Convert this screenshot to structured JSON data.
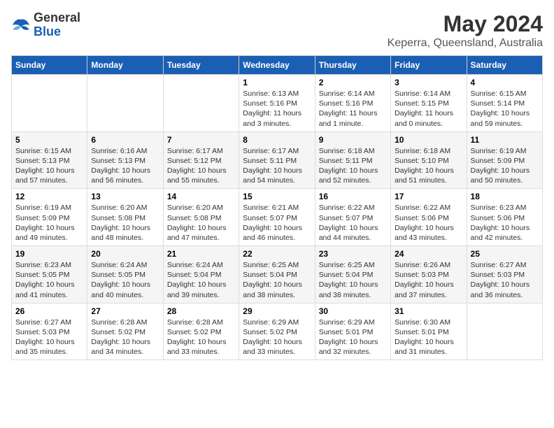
{
  "header": {
    "logo_line1": "General",
    "logo_line2": "Blue",
    "title": "May 2024",
    "subtitle": "Keperra, Queensland, Australia"
  },
  "weekdays": [
    "Sunday",
    "Monday",
    "Tuesday",
    "Wednesday",
    "Thursday",
    "Friday",
    "Saturday"
  ],
  "weeks": [
    [
      {
        "day": "",
        "detail": ""
      },
      {
        "day": "",
        "detail": ""
      },
      {
        "day": "",
        "detail": ""
      },
      {
        "day": "1",
        "detail": "Sunrise: 6:13 AM\nSunset: 5:16 PM\nDaylight: 11 hours and 3 minutes."
      },
      {
        "day": "2",
        "detail": "Sunrise: 6:14 AM\nSunset: 5:16 PM\nDaylight: 11 hours and 1 minute."
      },
      {
        "day": "3",
        "detail": "Sunrise: 6:14 AM\nSunset: 5:15 PM\nDaylight: 11 hours and 0 minutes."
      },
      {
        "day": "4",
        "detail": "Sunrise: 6:15 AM\nSunset: 5:14 PM\nDaylight: 10 hours and 59 minutes."
      }
    ],
    [
      {
        "day": "5",
        "detail": "Sunrise: 6:15 AM\nSunset: 5:13 PM\nDaylight: 10 hours and 57 minutes."
      },
      {
        "day": "6",
        "detail": "Sunrise: 6:16 AM\nSunset: 5:13 PM\nDaylight: 10 hours and 56 minutes."
      },
      {
        "day": "7",
        "detail": "Sunrise: 6:17 AM\nSunset: 5:12 PM\nDaylight: 10 hours and 55 minutes."
      },
      {
        "day": "8",
        "detail": "Sunrise: 6:17 AM\nSunset: 5:11 PM\nDaylight: 10 hours and 54 minutes."
      },
      {
        "day": "9",
        "detail": "Sunrise: 6:18 AM\nSunset: 5:11 PM\nDaylight: 10 hours and 52 minutes."
      },
      {
        "day": "10",
        "detail": "Sunrise: 6:18 AM\nSunset: 5:10 PM\nDaylight: 10 hours and 51 minutes."
      },
      {
        "day": "11",
        "detail": "Sunrise: 6:19 AM\nSunset: 5:09 PM\nDaylight: 10 hours and 50 minutes."
      }
    ],
    [
      {
        "day": "12",
        "detail": "Sunrise: 6:19 AM\nSunset: 5:09 PM\nDaylight: 10 hours and 49 minutes."
      },
      {
        "day": "13",
        "detail": "Sunrise: 6:20 AM\nSunset: 5:08 PM\nDaylight: 10 hours and 48 minutes."
      },
      {
        "day": "14",
        "detail": "Sunrise: 6:20 AM\nSunset: 5:08 PM\nDaylight: 10 hours and 47 minutes."
      },
      {
        "day": "15",
        "detail": "Sunrise: 6:21 AM\nSunset: 5:07 PM\nDaylight: 10 hours and 46 minutes."
      },
      {
        "day": "16",
        "detail": "Sunrise: 6:22 AM\nSunset: 5:07 PM\nDaylight: 10 hours and 44 minutes."
      },
      {
        "day": "17",
        "detail": "Sunrise: 6:22 AM\nSunset: 5:06 PM\nDaylight: 10 hours and 43 minutes."
      },
      {
        "day": "18",
        "detail": "Sunrise: 6:23 AM\nSunset: 5:06 PM\nDaylight: 10 hours and 42 minutes."
      }
    ],
    [
      {
        "day": "19",
        "detail": "Sunrise: 6:23 AM\nSunset: 5:05 PM\nDaylight: 10 hours and 41 minutes."
      },
      {
        "day": "20",
        "detail": "Sunrise: 6:24 AM\nSunset: 5:05 PM\nDaylight: 10 hours and 40 minutes."
      },
      {
        "day": "21",
        "detail": "Sunrise: 6:24 AM\nSunset: 5:04 PM\nDaylight: 10 hours and 39 minutes."
      },
      {
        "day": "22",
        "detail": "Sunrise: 6:25 AM\nSunset: 5:04 PM\nDaylight: 10 hours and 38 minutes."
      },
      {
        "day": "23",
        "detail": "Sunrise: 6:25 AM\nSunset: 5:04 PM\nDaylight: 10 hours and 38 minutes."
      },
      {
        "day": "24",
        "detail": "Sunrise: 6:26 AM\nSunset: 5:03 PM\nDaylight: 10 hours and 37 minutes."
      },
      {
        "day": "25",
        "detail": "Sunrise: 6:27 AM\nSunset: 5:03 PM\nDaylight: 10 hours and 36 minutes."
      }
    ],
    [
      {
        "day": "26",
        "detail": "Sunrise: 6:27 AM\nSunset: 5:03 PM\nDaylight: 10 hours and 35 minutes."
      },
      {
        "day": "27",
        "detail": "Sunrise: 6:28 AM\nSunset: 5:02 PM\nDaylight: 10 hours and 34 minutes."
      },
      {
        "day": "28",
        "detail": "Sunrise: 6:28 AM\nSunset: 5:02 PM\nDaylight: 10 hours and 33 minutes."
      },
      {
        "day": "29",
        "detail": "Sunrise: 6:29 AM\nSunset: 5:02 PM\nDaylight: 10 hours and 33 minutes."
      },
      {
        "day": "30",
        "detail": "Sunrise: 6:29 AM\nSunset: 5:01 PM\nDaylight: 10 hours and 32 minutes."
      },
      {
        "day": "31",
        "detail": "Sunrise: 6:30 AM\nSunset: 5:01 PM\nDaylight: 10 hours and 31 minutes."
      },
      {
        "day": "",
        "detail": ""
      }
    ]
  ]
}
